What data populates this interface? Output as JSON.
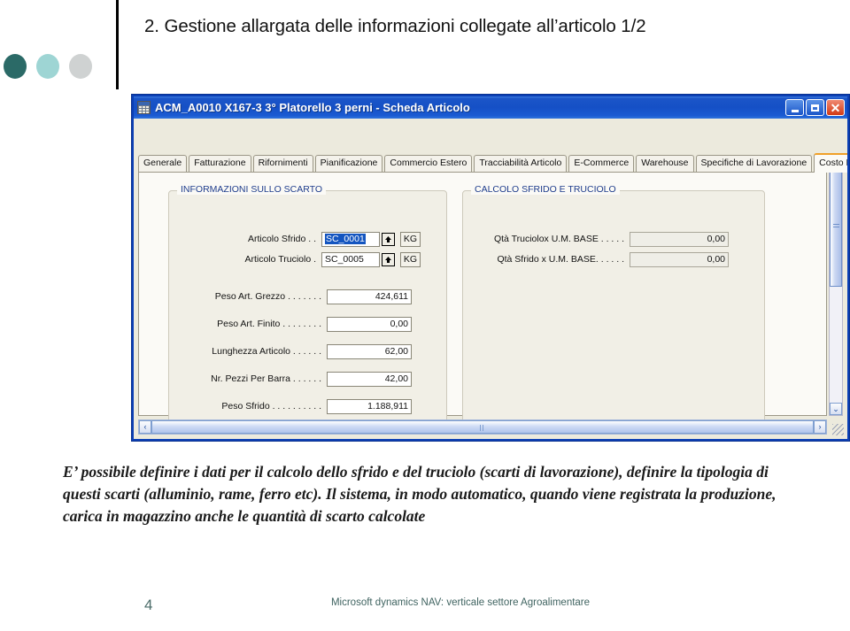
{
  "slide": {
    "title": "2. Gestione allargata delle informazioni collegate all’articolo 1/2",
    "body": "E’ possibile definire i dati per il calcolo dello sfrido e del truciolo (scarti di lavorazione), definire la tipologia di questi scarti (alluminio, rame, ferro etc). Il sistema, in modo automatico, quando viene registrata la produzione, carica in magazzino anche le quantità di scarto calcolate",
    "page_number": "4",
    "footer": "Microsoft dynamics NAV: verticale settore Agroalimentare",
    "dot_colors": [
      "#2b6a67",
      "#9ed5d4",
      "#cfd2d2"
    ]
  },
  "window": {
    "title": "ACM_A0010 X167-3 3° Platorello 3 perni - Scheda Articolo",
    "icon": "table-grid-icon",
    "buttons": {
      "minimize": "Minimize",
      "maximize": "Restore",
      "close": "✕"
    },
    "title_bar_color": "#1550c6",
    "accent_color": "#f0a028"
  },
  "tabs": [
    {
      "label": "Generale",
      "active": false
    },
    {
      "label": "Fatturazione",
      "active": false
    },
    {
      "label": "Rifornimenti",
      "active": false
    },
    {
      "label": "Pianificazione",
      "active": false
    },
    {
      "label": "Commercio Estero",
      "active": false
    },
    {
      "label": "Tracciabilità Articolo",
      "active": false
    },
    {
      "label": "E-Commerce",
      "active": false
    },
    {
      "label": "Warehouse",
      "active": false
    },
    {
      "label": "Specifiche di Lavorazione",
      "active": false
    },
    {
      "label": "Costo Materie Prime",
      "active": true
    }
  ],
  "group_scarto": {
    "legend": "INFORMAZIONI SULLO SCARTO",
    "fields": [
      {
        "label": "Articolo Sfrido . .",
        "value": "SC_0001",
        "selected": true,
        "lookup": "lookup-arrow-icon",
        "unit": "KG",
        "readonly": false
      },
      {
        "label": "Articolo Truciolo  .",
        "value": "SC_0005",
        "selected": false,
        "lookup": "lookup-arrow-icon",
        "unit": "KG",
        "readonly": false
      },
      {
        "label": "Peso Art. Grezzo . . . . . . .",
        "value": "424,611",
        "numeric": true,
        "readonly": false
      },
      {
        "label": "Peso Art. Finito . . . . . . . .",
        "value": "0,00",
        "numeric": true,
        "readonly": false
      },
      {
        "label": "Lunghezza Articolo . . . . . .",
        "value": "62,00",
        "numeric": true,
        "readonly": false
      },
      {
        "label": "Nr. Pezzi Per Barra . . . . . .",
        "value": "42,00",
        "numeric": true,
        "readonly": false
      },
      {
        "label": "Peso Sfrido . . . . . . . . . .",
        "value": "1.188,911",
        "numeric": true,
        "readonly": false
      }
    ]
  },
  "group_calcolo": {
    "legend": "CALCOLO SFRIDO E TRUCIOLO",
    "fields": [
      {
        "label": "Qtà Truciolox U.M. BASE . . . . .",
        "value": "0,00",
        "numeric": true,
        "readonly": true
      },
      {
        "label": "Qtà Sfrido x U.M. BASE. . . . . .",
        "value": "0,00",
        "numeric": true,
        "readonly": true
      }
    ]
  },
  "scrollbars": {
    "v_up": "⌃",
    "v_down": "⌄",
    "h_left": "‹",
    "h_right": "›"
  }
}
